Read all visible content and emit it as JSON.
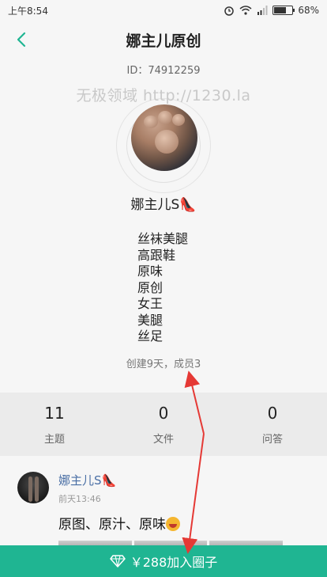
{
  "status_bar": {
    "time": "上午8:54",
    "battery": "68%",
    "battery_level": 0.68,
    "icons": [
      "alarm-icon",
      "wifi-icon",
      "signal-icon",
      "battery-icon"
    ]
  },
  "nav": {
    "title": "娜主儿原创",
    "back_icon": "back-arrow-icon"
  },
  "group": {
    "id_text": "ID：74912259",
    "watermark": "无极领域 http://1230.la",
    "owner": "娜主儿S👠",
    "tags": [
      "丝袜美腿",
      "高跟鞋",
      "原味",
      "原创",
      "女王",
      "美腿",
      "丝足"
    ],
    "created": "创建9天，成员3"
  },
  "stats": [
    {
      "num": "11",
      "label": "主题"
    },
    {
      "num": "0",
      "label": "文件"
    },
    {
      "num": "0",
      "label": "问答"
    }
  ],
  "post": {
    "user": "娜主儿S👠",
    "time": "前天13:46",
    "text": "原图、原汁、原味"
  },
  "join": {
    "label": "￥288加入圈子",
    "icon": "diamond-icon"
  },
  "colors": {
    "accent": "#1fb592",
    "annotation_arrow": "#e53935",
    "link_blue": "#4a6fa5"
  }
}
